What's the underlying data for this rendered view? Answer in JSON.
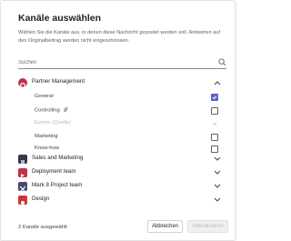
{
  "dialog": {
    "title": "Kanäle auswählen",
    "description": "Wählen Sie die Kanäle aus, in denen diese Nachricht gepostet werden soll. Antworten auf den Originalbeitrag werden nicht eingeschlossen."
  },
  "search": {
    "placeholder": "Suchen",
    "icon": "search-icon"
  },
  "teams": [
    {
      "label": "Partner Management",
      "color": "#c4314b",
      "expanded": true,
      "channels": [
        {
          "label": "General",
          "checked": true,
          "disabled": false
        },
        {
          "label": "Controlling",
          "checked": false,
          "disabled": false,
          "icon": "attachment-icon"
        },
        {
          "label": "Events (Quelle)",
          "checked": true,
          "disabled": true
        },
        {
          "label": "Marketing",
          "checked": false,
          "disabled": false
        },
        {
          "label": "Know-how",
          "checked": false,
          "disabled": false
        }
      ]
    },
    {
      "label": "Sales and Marketing",
      "color": "#36384a",
      "expanded": false
    },
    {
      "label": "Deployment team",
      "color": "#c4314b",
      "expanded": false
    },
    {
      "label": "Mark 8 Project team",
      "color": "#464775",
      "expanded": false
    },
    {
      "label": "Design",
      "color": "#d13438",
      "expanded": false
    }
  ],
  "footer": {
    "status": "2 Kanäle ausgewählt",
    "cancel_label": "Abbrechen",
    "update_label": "Aktualisieren"
  },
  "colors": {
    "accent": "#5b5fc7",
    "text": "#242424",
    "muted": "#616161"
  }
}
